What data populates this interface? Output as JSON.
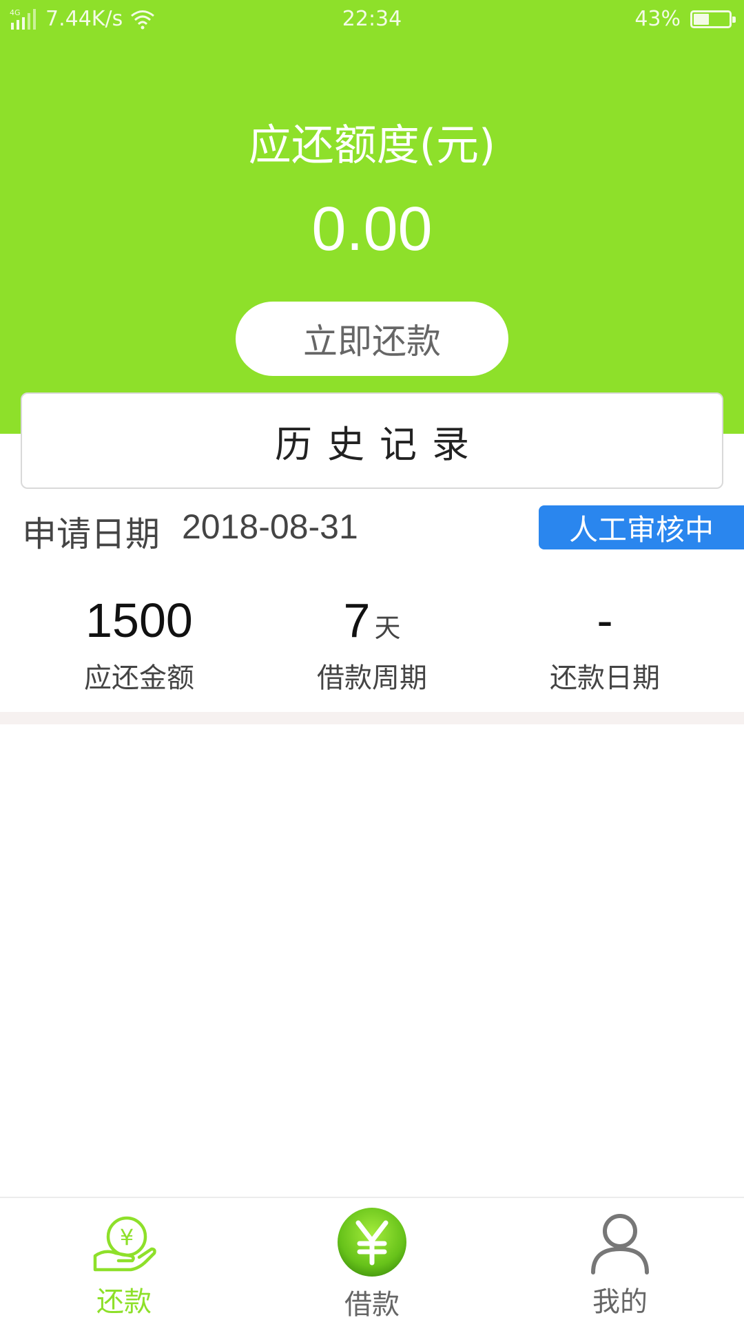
{
  "status_bar": {
    "network": "4G",
    "speed": "7.44K/s",
    "time": "22:34",
    "battery_percent": "43%",
    "battery_level": 0.43
  },
  "header": {
    "due_title": "应还额度(元)",
    "due_amount": "0.00",
    "repay_button": "立即还款",
    "background_color": "#8ee02a"
  },
  "history": {
    "title": "历史记录"
  },
  "record": {
    "apply_label": "申请日期",
    "apply_date": "2018-08-31",
    "status": "人工审核中",
    "status_color": "#2a86ee",
    "stats": [
      {
        "value": "1500",
        "unit": "",
        "label": "应还金额"
      },
      {
        "value": "7",
        "unit": "天",
        "label": "借款周期"
      },
      {
        "value": "-",
        "unit": "",
        "label": "还款日期"
      }
    ]
  },
  "tabbar": {
    "tabs": [
      {
        "label": "还款",
        "icon": "hand-yuan-icon",
        "active": true
      },
      {
        "label": "借款",
        "icon": "yuan-coin-icon",
        "active": false
      },
      {
        "label": "我的",
        "icon": "user-icon",
        "active": false
      }
    ],
    "active_color": "#8ee02a",
    "inactive_color": "#666666"
  }
}
